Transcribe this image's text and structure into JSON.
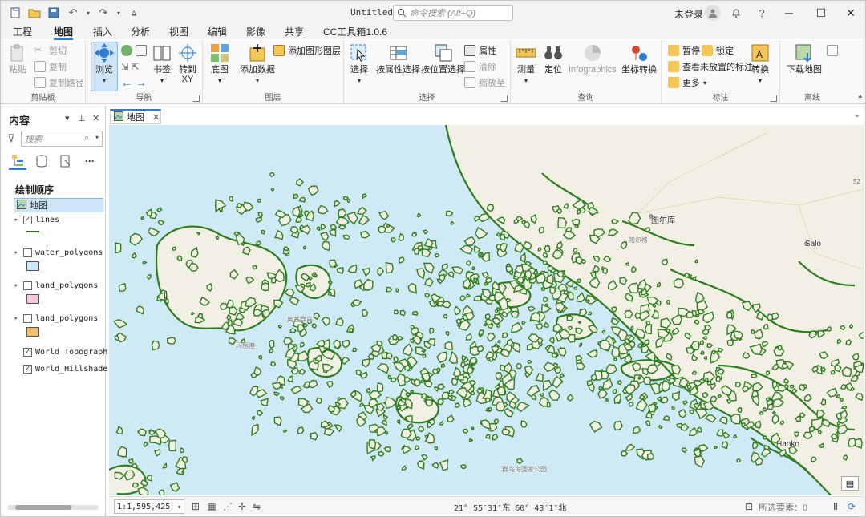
{
  "window": {
    "title": "Untitled",
    "command_search_placeholder": "命令搜索 (Alt+Q)",
    "user_label": "未登录",
    "help_label": "?"
  },
  "ribbon_tabs": [
    "工程",
    "地图",
    "插入",
    "分析",
    "视图",
    "编辑",
    "影像",
    "共享",
    "CC工具箱1.0.6"
  ],
  "active_tab": "地图",
  "ribbon": {
    "clipboard": {
      "label": "剪贴板",
      "paste": "粘贴",
      "cut": "剪切",
      "copy": "复制",
      "copy_path": "复制路径"
    },
    "navigate": {
      "label": "导航",
      "explore": "浏览",
      "bookmarks": "书签",
      "goto_xy": "转到\nXY"
    },
    "layer": {
      "label": "图层",
      "basemap": "底图",
      "add_data": "添加数据",
      "add_graphics": "添加图形图层"
    },
    "selection": {
      "label": "选择",
      "select": "选择",
      "by_attr": "按属性选择",
      "by_loc": "按位置选择",
      "attributes": "属性",
      "clear": "清除",
      "zoom_to": "缩放至"
    },
    "inquiry": {
      "label": "查询",
      "measure": "测量",
      "locate": "定位",
      "infographics": "Infographics",
      "coord_convert": "坐标转换"
    },
    "labeling": {
      "label": "标注",
      "pause": "暂停",
      "lock": "锁定",
      "view_unplaced": "查看未放置的标注",
      "more": "更多",
      "convert": "转换"
    },
    "offline": {
      "label": "离线",
      "download_map": "下载地图"
    }
  },
  "contents_pane": {
    "title": "内容",
    "search_placeholder": "搜索",
    "drawing_order_title": "绘制顺序",
    "map_node": "地图",
    "layers": [
      {
        "name": "lines",
        "checked": true,
        "symbol": "line",
        "color": "#2d7a1b"
      },
      {
        "name": "water_polygons",
        "checked": false,
        "symbol": "fill",
        "color": "#cbe6f7"
      },
      {
        "name": "land_polygons",
        "checked": false,
        "symbol": "fill",
        "color": "#f2c6dc"
      },
      {
        "name": "land_polygons",
        "checked": false,
        "symbol": "fill",
        "color": "#f0c16a"
      },
      {
        "name": "World Topographic",
        "checked": true,
        "symbol": "none",
        "color": ""
      },
      {
        "name": "World_Hillshade",
        "checked": true,
        "symbol": "none",
        "color": ""
      }
    ]
  },
  "map_view": {
    "tab_label": "地图",
    "place_labels": [
      "图尔库",
      "Salo",
      "Hanko",
      "52"
    ],
    "faded_labels": [
      "奥兰群岛",
      "玛丽港",
      "群岛海国家公园",
      "帕尔格"
    ],
    "colors": {
      "water": "#cfe9f6",
      "land": "#f2f0e4",
      "coastline": "#2e7d1e",
      "accent": "#2d7bd6"
    }
  },
  "status_bar": {
    "scale": "1:1,595,425",
    "coordinates": "21° 55′31″东  60° 43′1″北",
    "selected_features": "所选要素：0"
  }
}
